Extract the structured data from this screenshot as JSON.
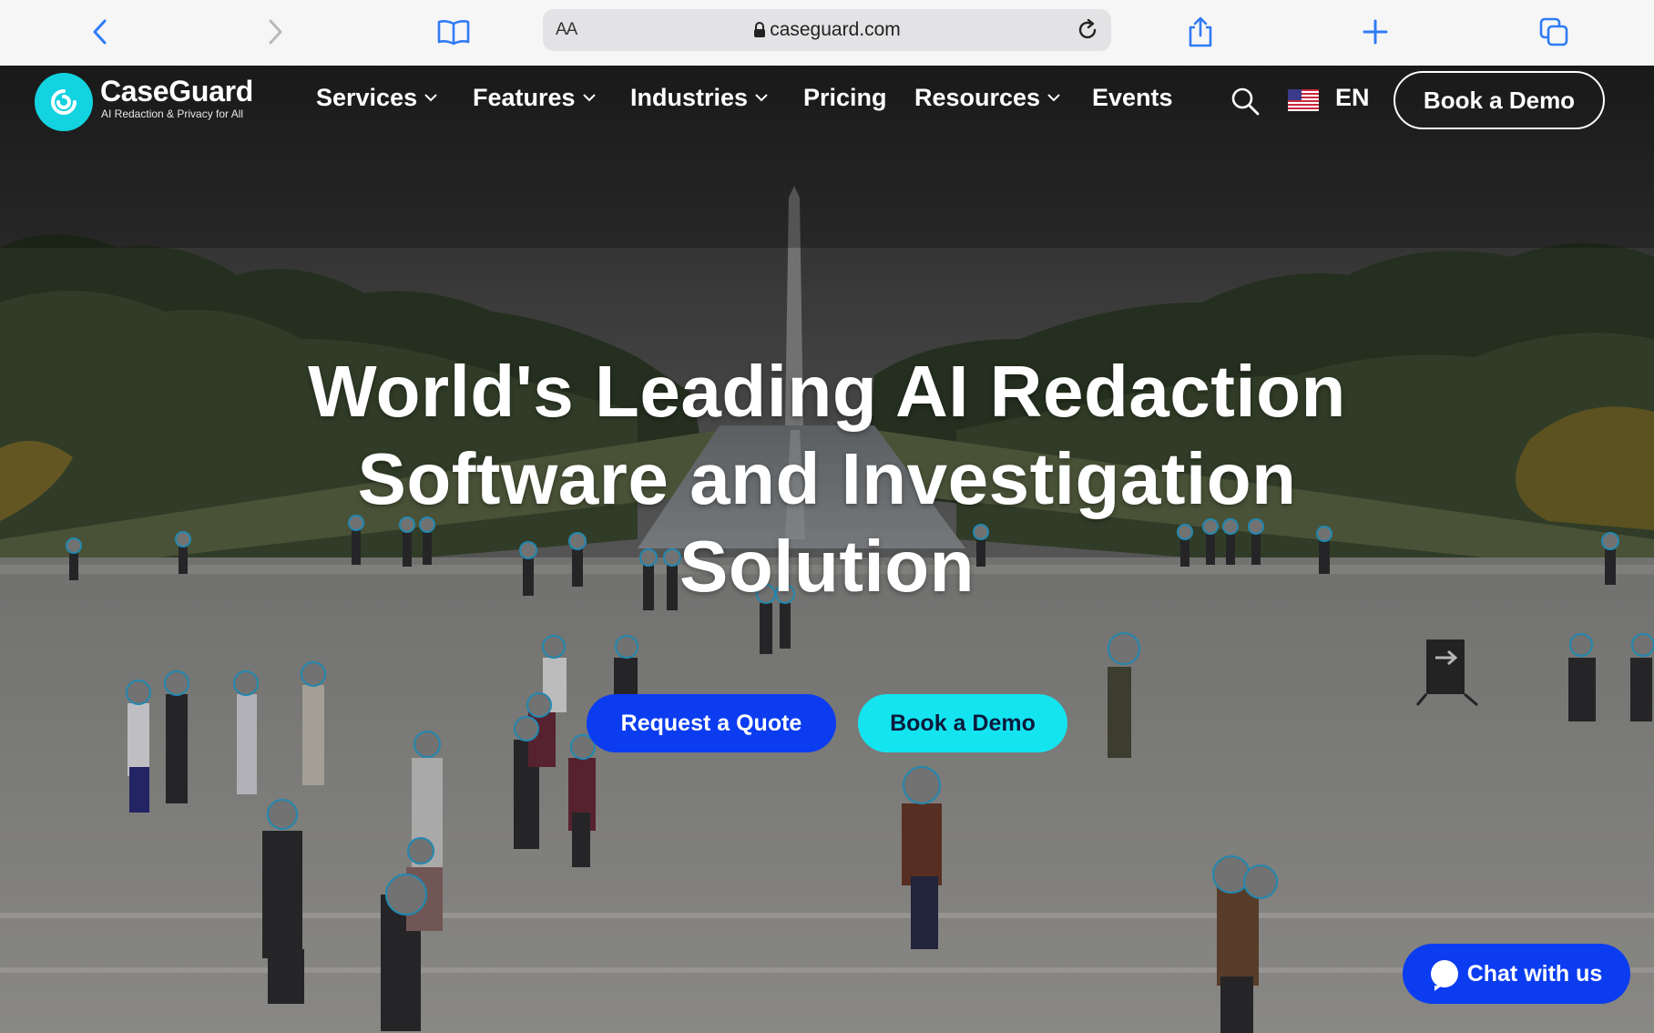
{
  "browser": {
    "text_size_label": "AA",
    "url": "caseguard.com"
  },
  "nav": {
    "brand_name": "CaseGuard",
    "brand_tagline": "AI Redaction & Privacy for All",
    "items": [
      {
        "label": "Services",
        "has_dropdown": true
      },
      {
        "label": "Features",
        "has_dropdown": true
      },
      {
        "label": "Industries",
        "has_dropdown": true
      },
      {
        "label": "Pricing",
        "has_dropdown": false
      },
      {
        "label": "Resources",
        "has_dropdown": true
      },
      {
        "label": "Events",
        "has_dropdown": false
      }
    ],
    "language": "EN",
    "demo_button": "Book a Demo"
  },
  "hero": {
    "title": "World's Leading AI Redaction Software and Investigation Solution",
    "quote_button": "Request a Quote",
    "demo_button": "Book a Demo"
  },
  "chat": {
    "label": "Chat with us"
  },
  "colors": {
    "brand_cyan": "#12d3df",
    "cta_blue": "#0b3cf0",
    "cta_cyan": "#14e4ef",
    "redaction_circle": "#2aa6d6"
  }
}
